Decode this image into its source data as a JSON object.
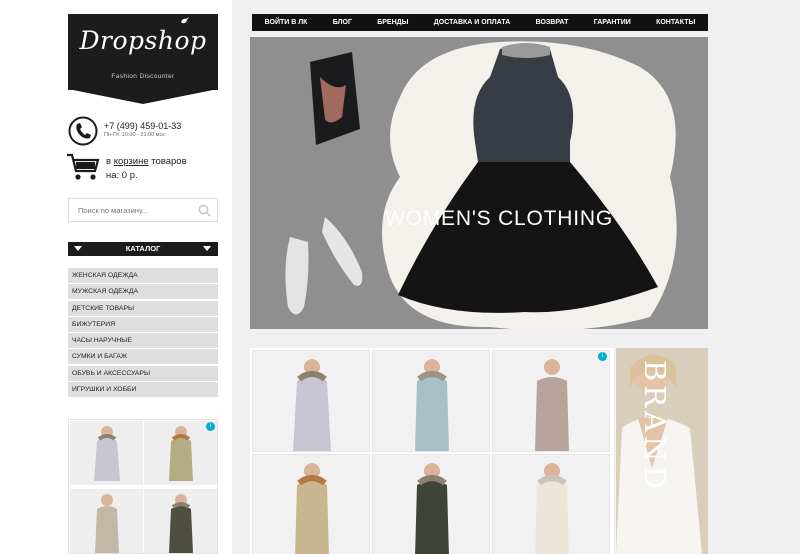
{
  "logo": {
    "name": "Dropshop",
    "tagline": "Fashion Discounter"
  },
  "contact": {
    "phone": "+7 (499) 459-01-33",
    "hours": "Пн-Пт. 10:00 - 21:00 мск"
  },
  "cart": {
    "prefix": "в",
    "link": "корзине",
    "suffix": "товаров",
    "total": "на: 0 р."
  },
  "search": {
    "placeholder": "Поиск по магазину..."
  },
  "catalog": {
    "title": "КАТАЛОГ"
  },
  "categories": [
    "ЖЕНСКАЯ ОДЕЖДА",
    "МУЖСКАЯ ОДЕЖДА",
    "ДЕТСКИЕ ТОВАРЫ",
    "БИЖУТЕРИЯ",
    "ЧАСЫ НАРУЧНЫЕ",
    "СУМКИ И БАГАЖ",
    "ОБУВЬ И АКСЕССУАРЫ",
    "ИГРУШКИ И ХОББИ"
  ],
  "nav": [
    "ВОЙТИ В ЛК",
    "БЛОГ",
    "БРЕНДЫ",
    "ДОСТАВКА И ОПЛАТА",
    "ВОЗВРАТ",
    "ГАРАНТИИ",
    "КОНТАКТЫ"
  ],
  "hero": {
    "label": "WOMEN'S CLOTHING"
  },
  "brand_ad": {
    "word": "BRAND"
  },
  "colors": {
    "dark": "#1c1c1c",
    "menu_bg": "#dedede",
    "adchoices": "#00aecd"
  }
}
